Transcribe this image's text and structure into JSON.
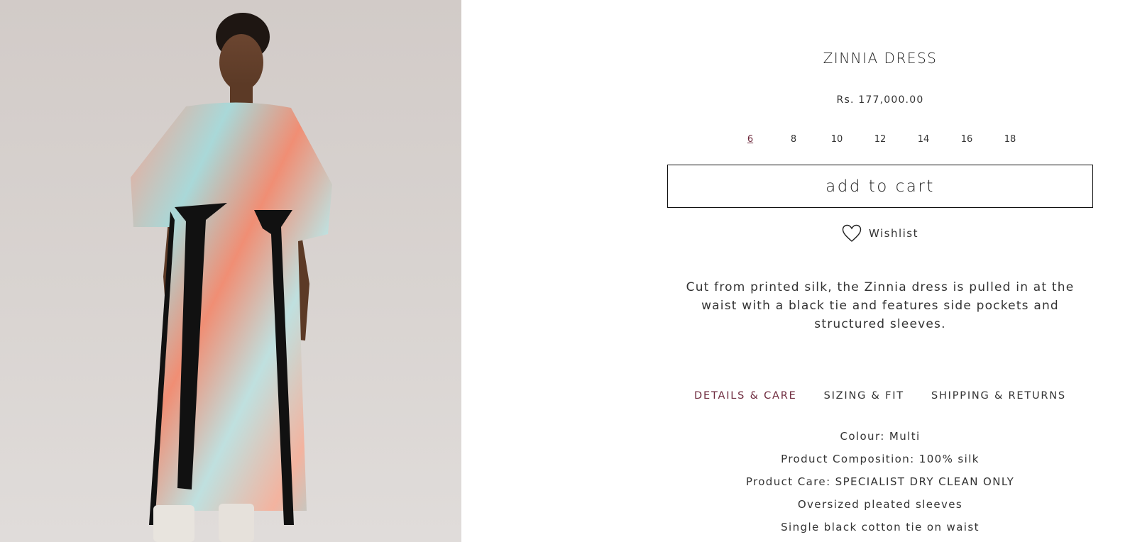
{
  "product": {
    "title": "ZINNIA DRESS",
    "price": "Rs. 177,000.00",
    "image_alt": "Model wearing printed silk Zinnia dress with black ties"
  },
  "sizes": [
    {
      "label": "6",
      "selected": true
    },
    {
      "label": "8",
      "selected": false
    },
    {
      "label": "10",
      "selected": false
    },
    {
      "label": "12",
      "selected": false
    },
    {
      "label": "14",
      "selected": false
    },
    {
      "label": "16",
      "selected": false
    },
    {
      "label": "18",
      "selected": false
    }
  ],
  "actions": {
    "add_to_cart": "add to cart",
    "wishlist": "Wishlist"
  },
  "description": "Cut from printed silk, the Zinnia dress is pulled in at the waist with a black tie and features side pockets and structured sleeves.",
  "tabs": [
    {
      "label": "DETAILS & CARE",
      "active": true
    },
    {
      "label": "SIZING & FIT",
      "active": false
    },
    {
      "label": "SHIPPING & RETURNS",
      "active": false
    }
  ],
  "details": [
    "Colour: Multi",
    "Product Composition: 100% silk",
    "Product Care: SPECIALIST DRY CLEAN ONLY",
    "Oversized pleated sleeves",
    "Single black cotton tie on waist"
  ],
  "colors": {
    "accent": "#6e2a3d",
    "text": "#333333",
    "border": "#111111",
    "image_background": "#d6d0cd"
  }
}
